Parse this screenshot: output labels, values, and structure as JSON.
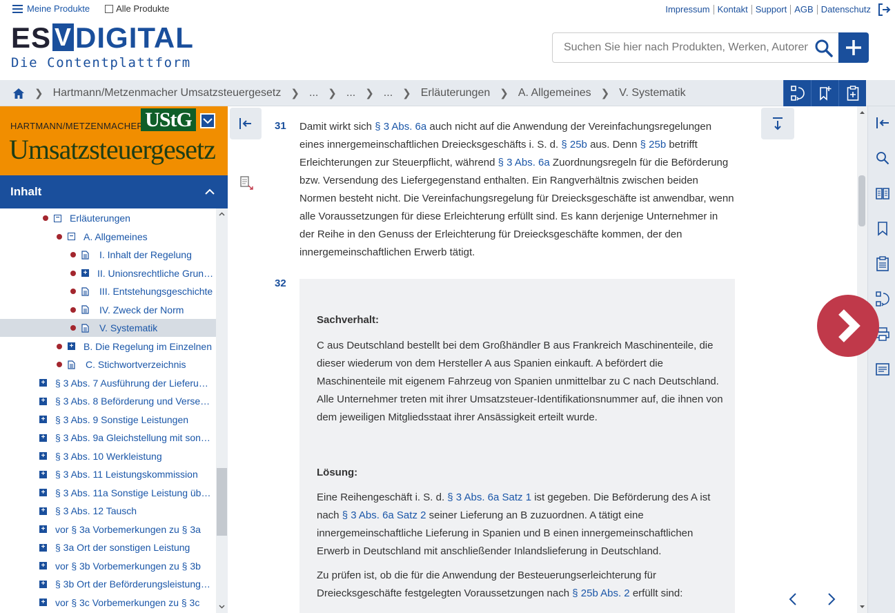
{
  "header": {
    "my_products": "Meine Produkte",
    "all_products": "Alle Produkte",
    "links": [
      "Impressum",
      "Kontakt",
      "Support",
      "AGB",
      "Datenschutz"
    ],
    "logo_part1": "ES",
    "logo_part2": "V",
    "logo_part3": "DIGITAL",
    "logo_sub": "Die Contentplattform",
    "search_placeholder": "Suchen Sie hier nach Produkten, Werken, Autoren"
  },
  "breadcrumb": [
    "Hartmann/Metzenmacher Umsatzsteuergesetz",
    "...",
    "...",
    "...",
    "Erläuterungen",
    "A. Allgemeines",
    "V. Systematik"
  ],
  "book": {
    "author": "HARTMANN/METZENMACHER",
    "badge": "UStG",
    "title": "Umsatzsteuergesetz"
  },
  "toc": {
    "heading": "Inhalt",
    "items": [
      {
        "label": "Erläuterungen",
        "level": 0,
        "expander": "minus",
        "dot": true
      },
      {
        "label": "A. Allgemeines",
        "level": 1,
        "expander": "minus",
        "dot": true
      },
      {
        "label": "I. Inhalt der Regelung",
        "level": 2,
        "expander": "doc",
        "dot": true
      },
      {
        "label": "II. Unionsrechtliche Grun…",
        "level": 2,
        "expander": "plus",
        "dot": true
      },
      {
        "label": "III. Entstehungsgeschichte",
        "level": 2,
        "expander": "doc",
        "dot": true
      },
      {
        "label": "IV. Zweck der Norm",
        "level": 2,
        "expander": "doc",
        "dot": true
      },
      {
        "label": "V. Systematik",
        "level": 2,
        "expander": "doc",
        "dot": true,
        "selected": true
      },
      {
        "label": "B. Die Regelung im Einzelnen",
        "level": 1,
        "expander": "plus",
        "dot": true
      },
      {
        "label": "C. Stichwortverzeichnis",
        "level": 1,
        "expander": "doc",
        "dot": true
      },
      {
        "label": "§ 3 Abs. 7 Ausführung der Lieferu…",
        "level": -1,
        "expander": "plus"
      },
      {
        "label": "§ 3 Abs. 8 Beförderung und Verse…",
        "level": -1,
        "expander": "plus"
      },
      {
        "label": "§ 3 Abs. 9 Sonstige Leistungen",
        "level": -1,
        "expander": "plus"
      },
      {
        "label": "§ 3 Abs. 9a Gleichstellung mit son…",
        "level": -1,
        "expander": "plus"
      },
      {
        "label": "§ 3 Abs. 10 Werkleistung",
        "level": -1,
        "expander": "plus"
      },
      {
        "label": "§ 3 Abs. 11 Leistungskommission",
        "level": -1,
        "expander": "plus"
      },
      {
        "label": "§ 3 Abs. 11a Sonstige Leistung üb…",
        "level": -1,
        "expander": "plus"
      },
      {
        "label": "§ 3 Abs. 12 Tausch",
        "level": -1,
        "expander": "plus"
      },
      {
        "label": "vor § 3a Vorbemerkungen zu § 3a",
        "level": -1,
        "expander": "plus"
      },
      {
        "label": "§ 3a Ort der sonstigen Leistung",
        "level": -1,
        "expander": "plus"
      },
      {
        "label": "vor § 3b Vorbemerkungen zu § 3b",
        "level": -1,
        "expander": "plus"
      },
      {
        "label": "§ 3b Ort der Beförderungsleistung…",
        "level": -1,
        "expander": "plus"
      },
      {
        "label": "vor § 3c Vorbemerkungen zu § 3c",
        "level": -1,
        "expander": "plus"
      }
    ]
  },
  "content": {
    "rn31": "31",
    "p31": [
      {
        "t": "Damit wirkt sich "
      },
      {
        "l": "§ 3 Abs. 6a"
      },
      {
        "t": " auch nicht auf die Anwendung der Vereinfachungsregelungen eines innergemeinschaftlichen Dreiecksgeschäfts i. S. d. "
      },
      {
        "l": "§ 25b"
      },
      {
        "t": " aus. Denn "
      },
      {
        "l": "§ 25b"
      },
      {
        "t": " betrifft Erleichterungen zur Steuerpflicht, während "
      },
      {
        "l": "§ 3 Abs. 6a"
      },
      {
        "t": " Zuordnungsregeln für die Beförderung bzw. Versendung des Liefergegenstand enthalten. Ein Rangverhältnis zwischen beiden Normen besteht nicht. Die Vereinfachungsregelung für Dreiecksgeschäfte ist anwendbar, wenn alle Voraussetzungen für diese Erleichterung erfüllt sind. Es kann derjenige Unternehmer in der Reihe in den Genuss der Erleichterung für Dreiecksgeschäfte kommen, der den innergemeinschaftlichen Erwerb tätigt."
      }
    ],
    "rn32": "32",
    "sachverhalt_heading": "Sachverhalt:",
    "sachverhalt_text": "C aus Deutschland bestellt bei dem Großhändler B aus Frankreich Maschinenteile, die dieser wiederum von dem Hersteller A aus Spanien einkauft. A befördert die Maschinenteile mit eigenem Fahrzeug von Spanien unmittelbar zu C nach Deutschland. Alle Unternehmer treten mit ihrer Umsatzsteuer-Identifikationsnummer auf, die ihnen von dem jeweiligen Mitgliedsstaat ihrer Ansässigkeit erteilt wurde.",
    "loesung_heading": "Lösung:",
    "loesung_p1": [
      {
        "t": "Eine Reihengeschäft i. S. d. "
      },
      {
        "l": "§ 3 Abs. 6a Satz 1"
      },
      {
        "t": " ist gegeben. Die Beförderung des A ist nach "
      },
      {
        "l": "§ 3 Abs. 6a Satz 2"
      },
      {
        "t": " seiner Lieferung an B zuzuordnen. A tätigt eine innergemeinschaftliche Lieferung in Spanien und B einen innergemeinschaftlichen Erwerb in Deutschland mit anschließender Inlandslieferung in Deutschland."
      }
    ],
    "loesung_p2": [
      {
        "t": "Zu prüfen ist, ob die für die Anwendung der Besteuerungserleichterung für Dreiecksgeschäfte festgelegten Voraussetzungen nach "
      },
      {
        "l": "§ 25b Abs. 2"
      },
      {
        "t": " erfüllt sind:"
      }
    ]
  },
  "colors": {
    "brand_blue": "#1a4f9c",
    "banner_orange": "#f18e00",
    "badge_green": "#0f5e28",
    "next_red": "#c0394a",
    "dot_red": "#a3262e"
  },
  "icons": {
    "rail": [
      "collapse-right-icon",
      "search-icon",
      "book-icon",
      "bookmark-icon",
      "clipboard-icon",
      "history-icon",
      "print-icon",
      "notes-icon"
    ],
    "breadcrumb_tools": [
      "history-icon",
      "bookmark-add-icon",
      "clipboard-add-icon"
    ]
  }
}
